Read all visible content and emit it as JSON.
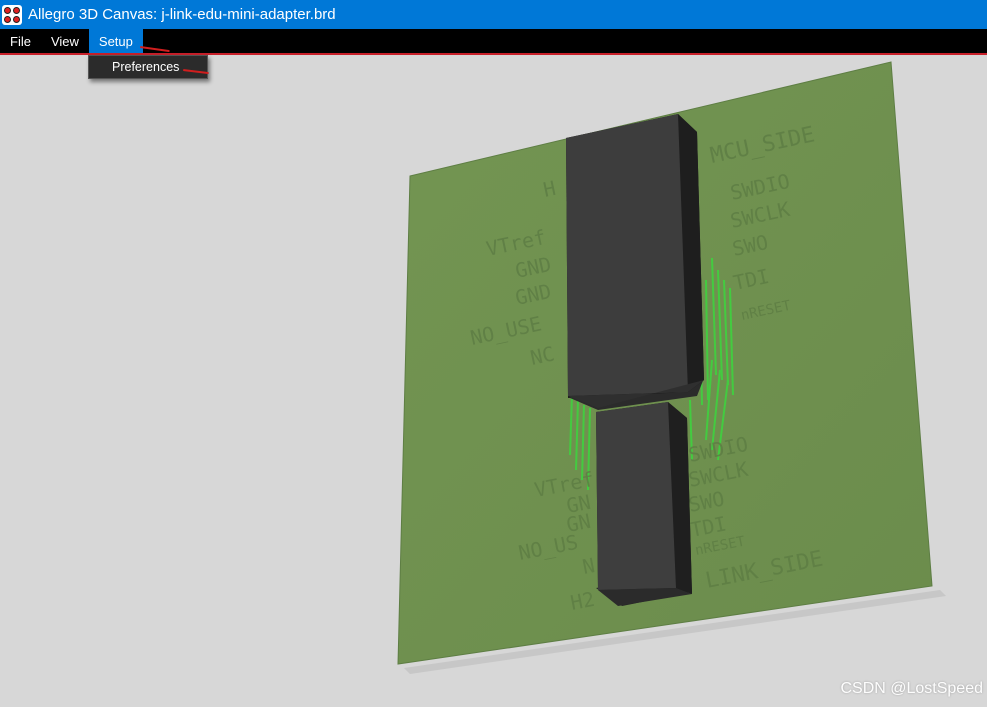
{
  "window": {
    "title": "Allegro 3D Canvas: j-link-edu-mini-adapter.brd",
    "icon": "allegro-app-icon"
  },
  "menu": {
    "file": "File",
    "view": "View",
    "setup": "Setup"
  },
  "setup_menu": {
    "preferences": "Preferences"
  },
  "board": {
    "color": "#6f9050",
    "silk_color": "#5f7f45",
    "trace_color": "#3fd23f",
    "component_color": "#3c3c3c",
    "labels": {
      "mcu_side": "MCU_SIDE",
      "h_top": "H",
      "vtref_top": "VTref",
      "gnd_top_1": "GND",
      "gnd_top_2": "GND",
      "no_use_top": "NO_USE",
      "nc_top": "NC",
      "swdio_top": "SWDIO",
      "swclk_top": "SWCLK",
      "swo_top": "SWO",
      "tdi_top": "TDI",
      "nreset_top": "nRESET",
      "swdio_bottom": "SWDIO",
      "swclk_bottom": "SWCLK",
      "swo_bottom": "SWO",
      "tdi_bottom": "TDI",
      "nreset_bottom": "nRESET",
      "vtref_bottom": "VTref",
      "gnd_bottom_1": "GN",
      "gnd_bottom_2": "GN",
      "no_use_bottom": "NO_US",
      "nc_bottom": "N",
      "h2": "H2",
      "jlink_side": "LINK_SIDE"
    }
  },
  "watermark": "CSDN @LostSpeed"
}
